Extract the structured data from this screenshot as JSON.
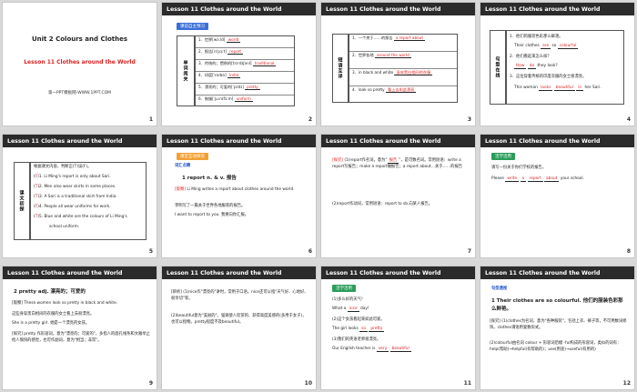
{
  "header_title": "Lesson 11    Clothes around the World",
  "slide1": {
    "unit": "Unit 2  Colours and Clothes",
    "lesson": "Lesson 11  Clothes around the World",
    "credit": "第一PPT模板网-WWW.1PPT.COM",
    "num": "1"
  },
  "slide2": {
    "tag": "课前自主预习",
    "side": "单词阅关",
    "rows": [
      {
        "text": "1．世界[wɜːld]",
        "answer": "world"
      },
      {
        "text": "2．报告[rɪˈpɔːt]",
        "answer": "report"
      },
      {
        "text": "3．传统的；惯例的[trəˈdɪʃənl]",
        "answer": "traditional"
      },
      {
        "text": "4．印度[ˈɪndɪə]",
        "answer": "India"
      },
      {
        "text": "5．漂亮的；可爱的[ˈprɪtɪ]",
        "answer": "pretty"
      },
      {
        "text": "6．制服[ˈjuːnɪfɔːm]",
        "answer": "uniform"
      }
    ],
    "num": "2"
  },
  "slide3": {
    "side": "短语互译",
    "rows": [
      {
        "text": "1．一个关于……的报告",
        "answer": "a report about"
      },
      {
        "text": "2．世界各地",
        "answer": "around the world"
      },
      {
        "text": "3．in black and white",
        "answer": "身穿黑白相间的衣服"
      },
      {
        "text": "4．look so pretty",
        "answer": "看上去如此漂亮"
      }
    ],
    "num": "3"
  },
  "slide4": {
    "side": "句型在线",
    "lines": [
      "1．他们的服装色彩那么鲜艳。",
      "Their clothes",
      "so",
      "2．他们看起来怎么样？",
      "How",
      "do",
      "they look?",
      "3．这位穿着传统的印度衣服的女士很漂亮。",
      "This woman",
      "looks",
      "beautiful",
      "in",
      "her Sari."
    ],
    "answers": {
      "a1": "are",
      "a2": "colourful"
    },
    "num": "4"
  },
  "slide5": {
    "side": "课文初探",
    "intro": "根据课文内容，判断正(T)误(F)。",
    "rows": [
      {
        "mark": "F",
        "text": ")1. Li Ming's report is only about Sari."
      },
      {
        "mark": "T",
        "text": ")2. Men also wear skirts in some places."
      },
      {
        "mark": "T",
        "text": ")3. A Sari is a traditional skirt from India."
      },
      {
        "mark": "F",
        "text": ")4. People all wear uniforms for work."
      },
      {
        "mark": "T",
        "text": ")5. Blue and white are the colours of Li Ming's"
      }
    ],
    "last": "school uniform.",
    "num": "5"
  },
  "slide6": {
    "tag": "课堂互动探究",
    "sub": "词汇点睛",
    "word": "1    report  n. & v. 报告",
    "ex_label": "[观察]",
    "ex": "Li Ming writes a report about clothes around the world.",
    "ex_cn": "李明写了一篇关于世界各地服装的报告。",
    "ex2": "I want to report to you. 我要向你汇报。",
    "num": "6"
  },
  "slide7": {
    "label": "[探究]",
    "text1": "(1)report作名词，意为",
    "ans1": "报告",
    "text2": "，是可数名词。常用短语：write a report写报告；make a report做报告；a report about…关于……的报告",
    "text3": "(2)report作动词，常用短语：report to sb.向某人报告。",
    "num": "7"
  },
  "slide8": {
    "tag": "活学活用",
    "q": "请写一份关于你们学校的报告。",
    "pre": "Please",
    "a1": "write",
    "a2": "a",
    "a3": "report",
    "a4": "about",
    "post": "your school.",
    "num": "8"
  },
  "slide9": {
    "word": "2    pretty  adj. 漂亮的；可爱的",
    "p1": "[观察] These women look so pretty in black and white.",
    "p2": "这些身穿黑白相间的衣服的女士看上去很漂亮。",
    "p3": "She is a pretty girl. 她是一个漂亮的女孩。",
    "p4": "[探究] pretty 作形容词，意为\"漂亮的；可爱的\"，多指人的面孔线条和文雅举止给人愉快的感觉，也可作副词，意为\"相当；非常\"。",
    "num": "9"
  },
  "slide10": {
    "p1": "[辨析] (1)nice作\"漂亮的\"讲时，常用于口语。nice还可以指\"天气好、心地好、很亲切\"等。",
    "p2": "(2)beautiful意为\"美丽的\"，强调使人欣赏的、获得高度美感的(多用于女子)，也可以指物。pretty程度不及beautiful。",
    "num": "10"
  },
  "slide11": {
    "tag": "活学活用",
    "q1": "(1)多么好的天气！",
    "l1": "What a",
    "a1": "nice",
    "l1b": "day!",
    "q2": "(2)这个女孩看起来如此可爱。",
    "l2": "The girl looks",
    "a2a": "so",
    "a2b": "pretty",
    "q3": "(3)我们的英语老师很漂亮。",
    "l3": "Our English teacher is",
    "a3a": "very",
    "a3b": "beautiful",
    "num": "11"
  },
  "slide12": {
    "sub": "句型透视",
    "line": "1    Their clothes are so colourful. 他们的服装色彩那么鲜艳。",
    "p1": "[探究] (1)clothes为名词，意为\"各种服装\"，包括上衣、裤子等，不可用数词修饰。clothes谓语用复数形式。",
    "p2": "(2)colourful由名词 colour + 形容词后缀 -ful构成的形容词，类似的词有：help(帮助)→helpful(有帮助的)；use(用途)→useful(有用的)",
    "num": "12"
  }
}
